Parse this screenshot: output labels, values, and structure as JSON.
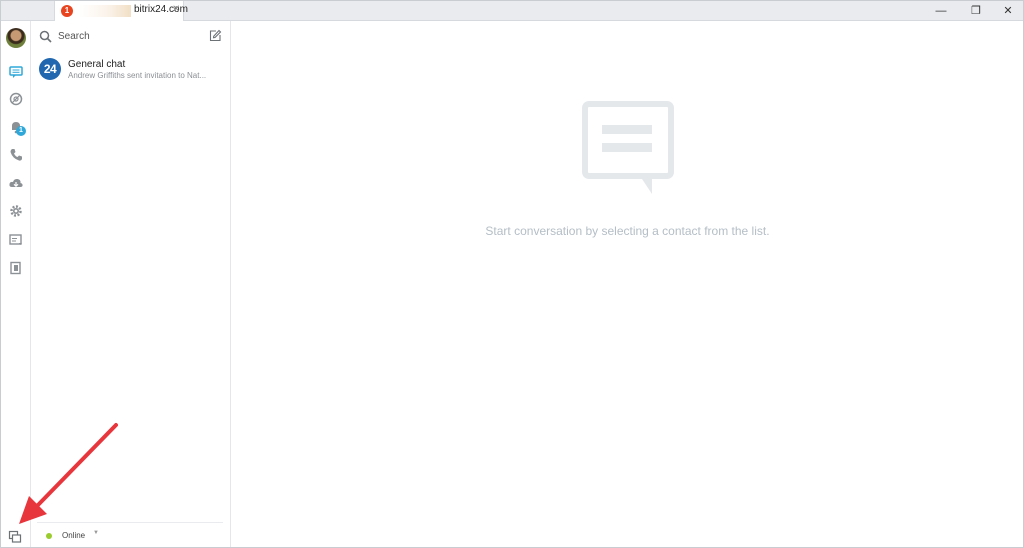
{
  "tab": {
    "badge": "1",
    "title": "bitrix24.com",
    "close_glyph": "✕"
  },
  "window_controls": {
    "minimize": "—",
    "maximize": "❐",
    "close": "✕"
  },
  "iconbar": {
    "items": [
      {
        "icon": "chat-icon"
      },
      {
        "icon": "open-channels-icon"
      },
      {
        "icon": "notifications-icon",
        "badge": "1"
      },
      {
        "icon": "phone-icon"
      },
      {
        "icon": "disk-icon"
      },
      {
        "icon": "settings-icon"
      },
      {
        "icon": "tasks-icon"
      },
      {
        "icon": "news-icon"
      }
    ],
    "bottom_icon": "window-switch-icon"
  },
  "contacts": {
    "search_label": "Search",
    "chats": [
      {
        "avatar_text": "24",
        "name": "General chat",
        "preview": "Andrew Griffiths sent invitation to Nat..."
      }
    ]
  },
  "status": {
    "label": "Online",
    "color": "#9acc2e"
  },
  "main": {
    "empty_text": "Start conversation by selecting a contact from the list."
  },
  "colors": {
    "accent": "#2fa8d9",
    "brand": "#2067b0",
    "notification": "#e8441f",
    "annotation_arrow": "#e8363d"
  }
}
